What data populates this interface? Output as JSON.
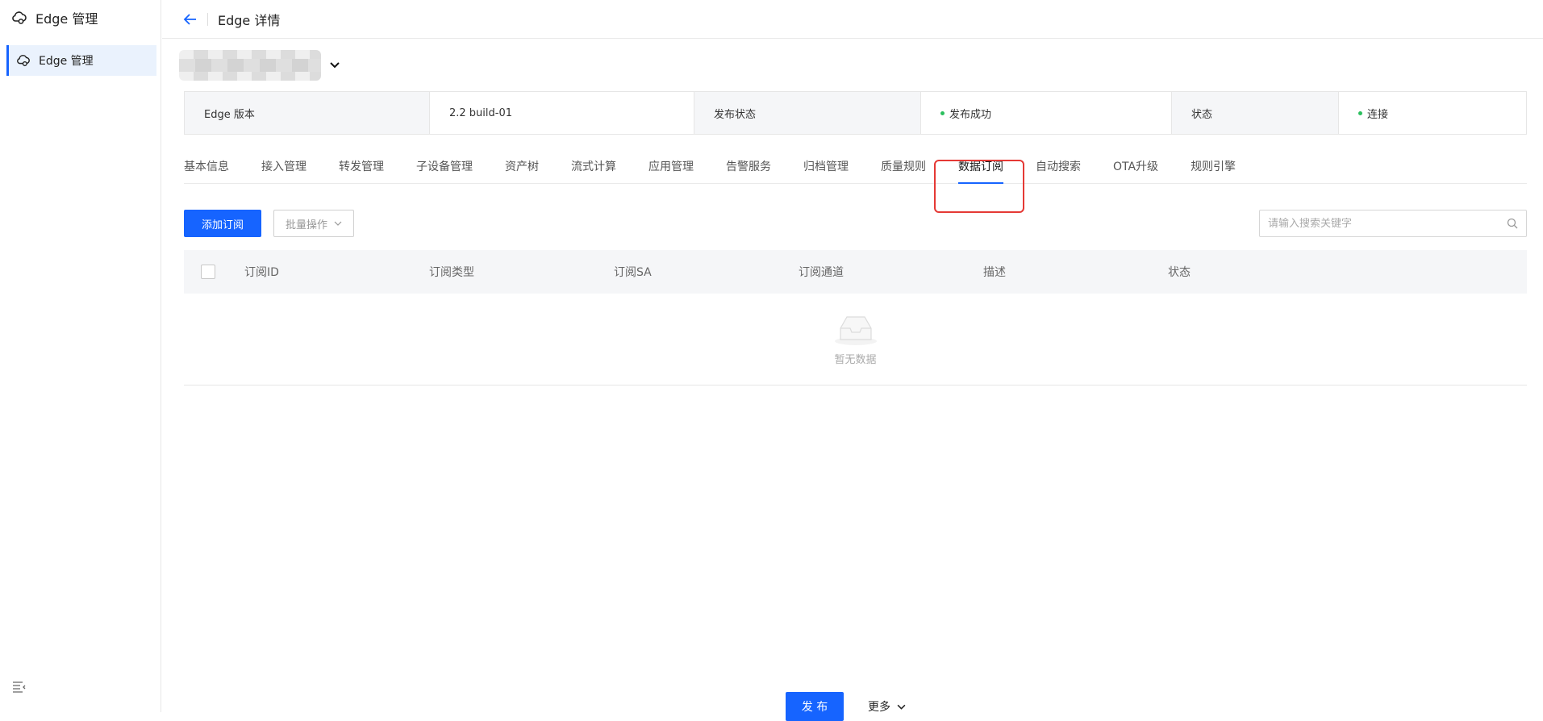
{
  "sidebar": {
    "title": "Edge 管理",
    "items": [
      {
        "label": "Edge 管理"
      }
    ]
  },
  "topbar": {
    "title": "Edge 详情"
  },
  "info": {
    "version_label": "Edge 版本",
    "version_value": "2.2 build-01",
    "publish_label": "发布状态",
    "publish_value": "发布成功",
    "status_label": "状态",
    "status_value": "连接"
  },
  "tabs": [
    {
      "label": "基本信息"
    },
    {
      "label": "接入管理"
    },
    {
      "label": "转发管理"
    },
    {
      "label": "子设备管理"
    },
    {
      "label": "资产树"
    },
    {
      "label": "流式计算"
    },
    {
      "label": "应用管理"
    },
    {
      "label": "告警服务"
    },
    {
      "label": "归档管理"
    },
    {
      "label": "质量规则"
    },
    {
      "label": "数据订阅"
    },
    {
      "label": "自动搜索"
    },
    {
      "label": "OTA升级"
    },
    {
      "label": "规则引擎"
    }
  ],
  "active_tab": "数据订阅",
  "toolbar": {
    "add_label": "添加订阅",
    "batch_label": "批量操作",
    "search_placeholder": "请输入搜索关键字"
  },
  "table": {
    "columns": [
      "订阅ID",
      "订阅类型",
      "订阅SA",
      "订阅通道",
      "描述",
      "状态"
    ],
    "empty_text": "暂无数据"
  },
  "footer": {
    "publish_label": "发 布",
    "more_label": "更多"
  },
  "colors": {
    "primary": "#1664ff",
    "success": "#2bbf5e",
    "highlight": "#e53935"
  }
}
